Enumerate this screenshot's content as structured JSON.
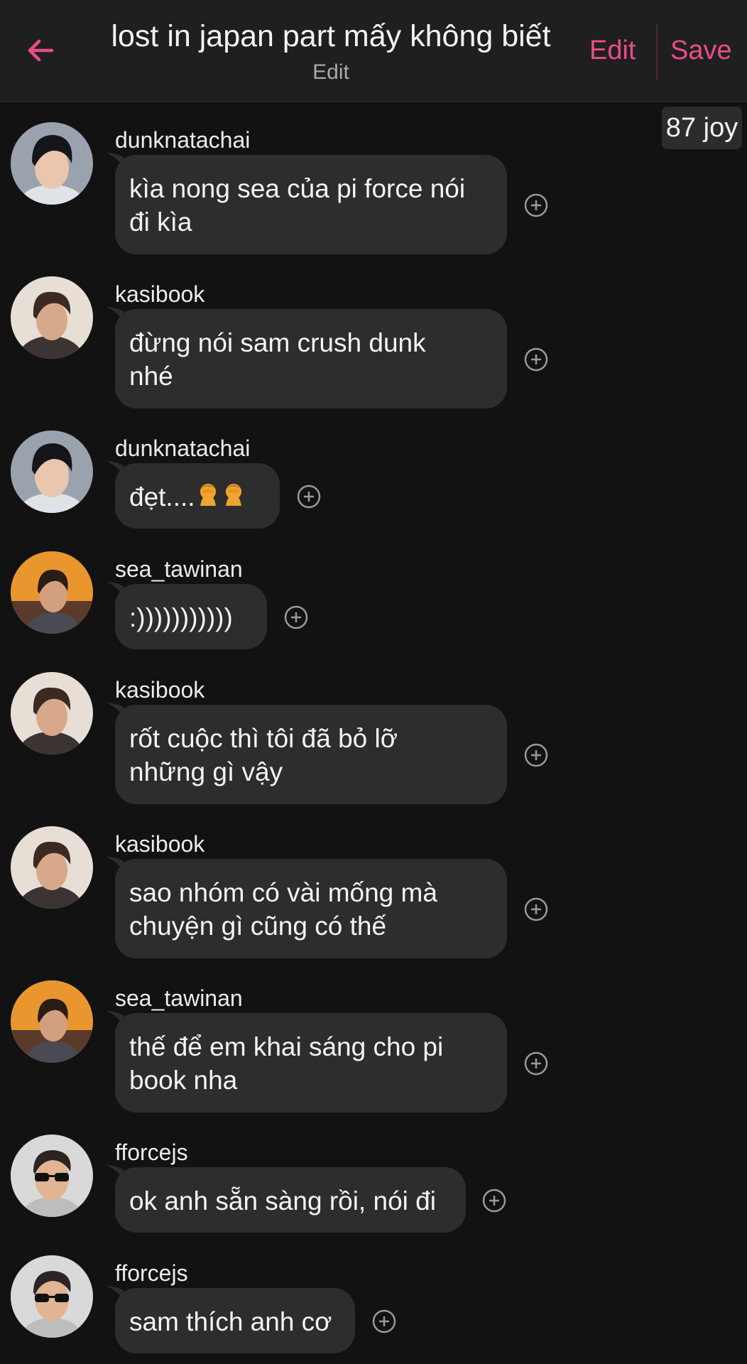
{
  "header": {
    "title": "lost in japan part mấy không biết",
    "subtitle": "Edit",
    "edit_label": "Edit",
    "save_label": "Save",
    "accent_color": "#ea4c89"
  },
  "joy_badge": "87 joy",
  "messages": [
    {
      "user": "dunknatachai",
      "text": "kìa nong sea của pi force nói\nđi kìa",
      "avatar": "avatar-dark-hair"
    },
    {
      "user": "kasibook",
      "text": "đừng nói sam crush dunk\nnhé",
      "avatar": "avatar-brown-hair"
    },
    {
      "user": "dunknatachai",
      "text": "đẹt....",
      "emoji": [
        "facepalm-emoji",
        "facepalm-emoji"
      ],
      "avatar": "avatar-dark-hair"
    },
    {
      "user": "sea_tawinan",
      "text": ":)))))))))))",
      "avatar": "avatar-sunset"
    },
    {
      "user": "kasibook",
      "text": "rốt cuộc thì tôi đã bỏ lỡ\nnhững gì vậy",
      "avatar": "avatar-brown-hair"
    },
    {
      "user": "kasibook",
      "text": "sao nhóm có vài mống mà\nchuyện gì cũng có thế",
      "avatar": "avatar-brown-hair"
    },
    {
      "user": "sea_tawinan",
      "text": "thế để em khai sáng cho pi\nbook nha",
      "avatar": "avatar-sunset"
    },
    {
      "user": "fforcejs",
      "text": "ok anh sẵn sàng rồi, nói đi",
      "avatar": "avatar-sunglasses"
    },
    {
      "user": "fforcejs",
      "text": "sam thích anh cơ",
      "avatar": "avatar-sunglasses"
    }
  ]
}
